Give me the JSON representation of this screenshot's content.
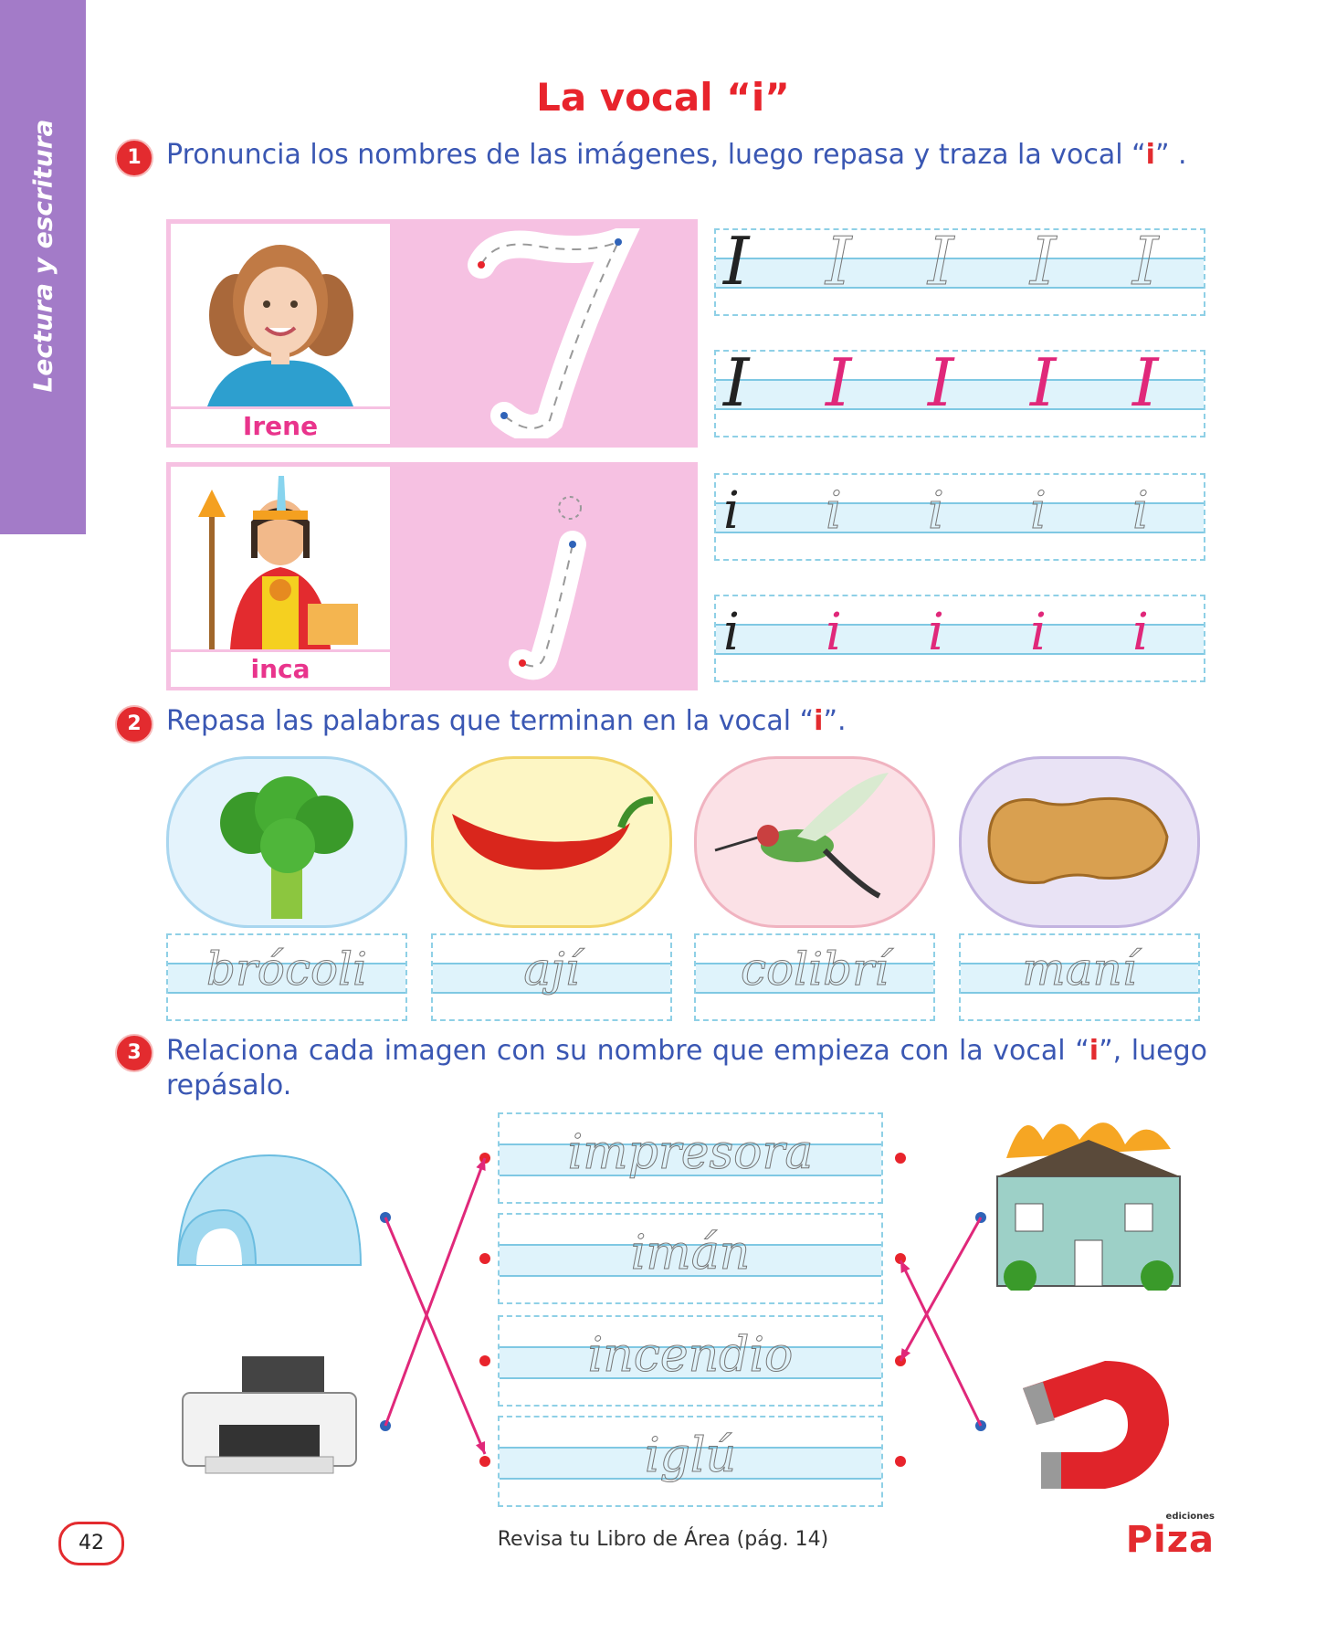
{
  "side_tab": {
    "label": "Lectura y escritura"
  },
  "title": "La vocal “i”",
  "section1": {
    "number": "1",
    "instruction_pre": "Pronuncia los nombres de las imágenes, luego repasa y traza la vocal “",
    "instruction_bold": "i",
    "instruction_post": "” .",
    "cards": [
      {
        "name": "Irene",
        "letter": "I",
        "image": "girl-photo"
      },
      {
        "name": "inca",
        "letter": "i",
        "image": "inca-illustration"
      }
    ],
    "rows": [
      {
        "model": "I",
        "trace": [
          "I",
          "I",
          "I",
          "I"
        ]
      },
      {
        "model": "I",
        "trace": [
          "I",
          "I",
          "I",
          "I"
        ]
      },
      {
        "model": "i",
        "trace": [
          "i",
          "i",
          "i",
          "i"
        ]
      },
      {
        "model": "i",
        "trace": [
          "i",
          "i",
          "i",
          "i"
        ]
      }
    ]
  },
  "section2": {
    "number": "2",
    "instruction_pre": "Repasa las palabras que terminan en la vocal “",
    "instruction_bold": "i",
    "instruction_post": "”.",
    "items": [
      {
        "word": "brócoli",
        "image": "broccoli-image",
        "bg": "#e4f3fc",
        "border": "#a9d6ef"
      },
      {
        "word": "ají",
        "image": "chili-image",
        "bg": "#fdf6c4",
        "border": "#f2d56a"
      },
      {
        "word": "colibrí",
        "image": "hummingbird-image",
        "bg": "#fbe1e6",
        "border": "#f0b3c0"
      },
      {
        "word": "maní",
        "image": "peanut-image",
        "bg": "#e9e3f5",
        "border": "#c2b3e0"
      }
    ]
  },
  "section3": {
    "number": "3",
    "instruction_pre": "Relaciona cada imagen con su nombre que empieza con la vocal “",
    "instruction_bold": "i",
    "instruction_post": "”, luego repásalo.",
    "words": [
      "impresora",
      "imán",
      "incendio",
      "iglú"
    ],
    "left_images": [
      "igloo-image",
      "printer-image"
    ],
    "right_images": [
      "burning-house-image",
      "magnet-image"
    ]
  },
  "footer": {
    "page_number": "42",
    "text": "Revisa tu Libro de Área (pág. 14)",
    "brand": "Piza",
    "brand_small": "ediciones"
  },
  "colors": {
    "accent_red": "#e32b2f",
    "instruction_blue": "#3a57b3",
    "tab_purple": "#a37bc8",
    "name_pink": "#e9348c"
  }
}
